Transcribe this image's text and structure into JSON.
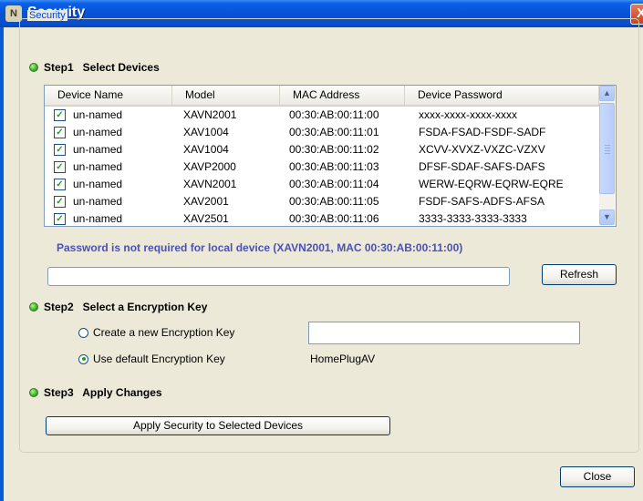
{
  "window": {
    "title": "Security",
    "icon_glyph": "N",
    "close_glyph": "X"
  },
  "group_label": "Security",
  "step1": {
    "label": "Step1   Select Devices"
  },
  "table": {
    "columns": [
      "Device Name",
      "Model",
      "MAC Address",
      "Device Password"
    ],
    "rows": [
      {
        "checked": true,
        "name": "un-named",
        "model": "XAVN2001",
        "mac": "00:30:AB:00:11:00",
        "password": "xxxx-xxxx-xxxx-xxxx"
      },
      {
        "checked": true,
        "name": "un-named",
        "model": "XAV1004",
        "mac": "00:30:AB:00:11:01",
        "password": "FSDA-FSAD-FSDF-SADF"
      },
      {
        "checked": true,
        "name": "un-named",
        "model": "XAV1004",
        "mac": "00:30:AB:00:11:02",
        "password": "XCVV-XVXZ-VXZC-VZXV"
      },
      {
        "checked": true,
        "name": "un-named",
        "model": "XAVP2000",
        "mac": "00:30:AB:00:11:03",
        "password": "DFSF-SDAF-SAFS-DAFS"
      },
      {
        "checked": true,
        "name": "un-named",
        "model": "XAVN2001",
        "mac": "00:30:AB:00:11:04",
        "password": "WERW-EQRW-EQRW-EQRE"
      },
      {
        "checked": true,
        "name": "un-named",
        "model": "XAV2001",
        "mac": "00:30:AB:00:11:05",
        "password": "FSDF-SAFS-ADFS-AFSA"
      },
      {
        "checked": true,
        "name": "un-named",
        "model": "XAV2501",
        "mac": "00:30:AB:00:11:06",
        "password": "3333-3333-3333-3333"
      }
    ]
  },
  "note": "Password is not required for local device (XAVN2001, MAC 00:30:AB:00:11:00)",
  "refresh_label": "Refresh",
  "step2": {
    "label": "Step2   Select a Encryption Key",
    "create_label": "Create a new Encryption Key",
    "default_label": "Use default Encryption Key",
    "default_value": "HomePlugAV",
    "selected": "default"
  },
  "step3": {
    "label": "Step3   Apply Changes"
  },
  "apply_label": "Apply Security to Selected Devices",
  "close_label": "Close"
}
